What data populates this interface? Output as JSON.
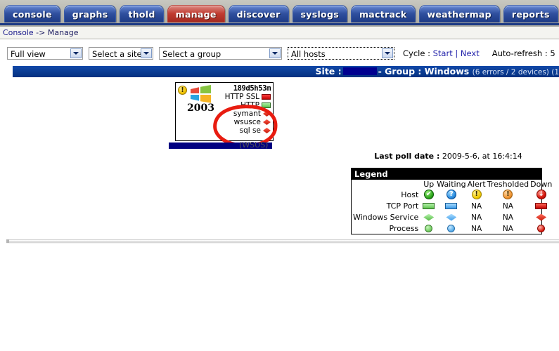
{
  "nav": {
    "tabs": [
      {
        "label": "console",
        "active": false
      },
      {
        "label": "graphs",
        "active": false
      },
      {
        "label": "thold",
        "active": false
      },
      {
        "label": "manage",
        "active": true
      },
      {
        "label": "discover",
        "active": false
      },
      {
        "label": "syslogs",
        "active": false
      },
      {
        "label": "mactrack",
        "active": false
      },
      {
        "label": "weathermap",
        "active": false
      },
      {
        "label": "reports",
        "active": false
      }
    ]
  },
  "breadcrumb": {
    "root": "Console",
    "separator": " -> ",
    "current": "Manage"
  },
  "filters": {
    "view_select": {
      "value": "Full view"
    },
    "site_select": {
      "value": "Select a site"
    },
    "group_select": {
      "value": "Select a group"
    },
    "hosts_select": {
      "value": "All hosts"
    },
    "cycle_label": "Cycle :",
    "cycle_start": "Start",
    "cycle_sep": "|",
    "cycle_next": "Next",
    "autorefresh_label": "Auto-refresh : 5"
  },
  "sitebar": {
    "site_label": "Site :",
    "site_value": "",
    "group_label": "- Group :",
    "group_value": "Windows",
    "stats": "(6 errors / 2 devices) (1"
  },
  "host_card": {
    "status_icon": "warning-icon",
    "os_logo": "windows-logo-icon",
    "os_version": "2003",
    "uptime": "189d5h53m",
    "ports": [
      {
        "label": "HTTP SSL",
        "state": "down",
        "icon": "tcp-port-down-icon"
      },
      {
        "label": "HTTP",
        "state": "up",
        "icon": "tcp-port-up-icon"
      }
    ],
    "services": [
      {
        "label": "symant",
        "state": "down",
        "icon": "windows-service-down-icon"
      },
      {
        "label": "wsusce",
        "state": "down",
        "icon": "windows-service-down-icon"
      },
      {
        "label": "sql se",
        "state": "down",
        "icon": "windows-service-down-icon"
      }
    ],
    "hostname_redacted": "",
    "hostname_suffix": "(WSUS)",
    "annotation": "red-circle-annotation"
  },
  "last_poll": {
    "label": "Last poll date :",
    "value": "2009-5-6, at 16:4:14"
  },
  "legend": {
    "title": "Legend",
    "columns": [
      "Up",
      "Waiting",
      "Alert",
      "Tresholded",
      "Down"
    ],
    "rows": [
      {
        "label": "Host",
        "cells": [
          {
            "kind": "circle",
            "state": "up",
            "icon": "host-up-icon",
            "glyph": "✔",
            "text": ""
          },
          {
            "kind": "circle",
            "state": "wait",
            "icon": "host-waiting-icon",
            "glyph": "?",
            "text": ""
          },
          {
            "kind": "circle",
            "state": "alert",
            "icon": "host-alert-icon",
            "glyph": "!",
            "text": ""
          },
          {
            "kind": "circle",
            "state": "thr",
            "icon": "host-tresholded-icon",
            "glyph": "!",
            "text": ""
          },
          {
            "kind": "circle",
            "state": "down",
            "icon": "host-down-icon",
            "glyph": "↓",
            "text": ""
          }
        ]
      },
      {
        "label": "TCP Port",
        "cells": [
          {
            "kind": "rect",
            "state": "green",
            "icon": "tcp-port-up-icon",
            "glyph": "",
            "text": ""
          },
          {
            "kind": "rect",
            "state": "blue",
            "icon": "tcp-port-waiting-icon",
            "glyph": "",
            "text": ""
          },
          {
            "kind": "na",
            "state": "",
            "icon": "not-available",
            "glyph": "",
            "text": "NA"
          },
          {
            "kind": "na",
            "state": "",
            "icon": "not-available",
            "glyph": "",
            "text": "NA"
          },
          {
            "kind": "rect",
            "state": "red",
            "icon": "tcp-port-down-icon",
            "glyph": "",
            "text": ""
          }
        ]
      },
      {
        "label": "Windows Service",
        "cells": [
          {
            "kind": "diamond",
            "state": "green",
            "icon": "windows-service-up-icon",
            "glyph": "",
            "text": ""
          },
          {
            "kind": "diamond",
            "state": "blue",
            "icon": "windows-service-waiting-icon",
            "glyph": "",
            "text": ""
          },
          {
            "kind": "na",
            "state": "",
            "icon": "not-available",
            "glyph": "",
            "text": "NA"
          },
          {
            "kind": "na",
            "state": "",
            "icon": "not-available",
            "glyph": "",
            "text": "NA"
          },
          {
            "kind": "diamond",
            "state": "red",
            "icon": "windows-service-down-icon",
            "glyph": "",
            "text": ""
          }
        ]
      },
      {
        "label": "Process",
        "cells": [
          {
            "kind": "dot",
            "state": "green",
            "icon": "process-up-icon",
            "glyph": "",
            "text": ""
          },
          {
            "kind": "dot",
            "state": "blue",
            "icon": "process-waiting-icon",
            "glyph": "",
            "text": ""
          },
          {
            "kind": "na",
            "state": "",
            "icon": "not-available",
            "glyph": "",
            "text": "NA"
          },
          {
            "kind": "na",
            "state": "",
            "icon": "not-available",
            "glyph": "",
            "text": "NA"
          },
          {
            "kind": "dot",
            "state": "red",
            "icon": "process-down-icon",
            "glyph": "",
            "text": ""
          }
        ]
      }
    ]
  },
  "colors": {
    "tab_blue": "#2f4f9e",
    "tab_active_red": "#c03b30",
    "titlebar_blue": "#0b3a8c",
    "redaction": "#00008f",
    "annotation_red": "#e81c10",
    "status_up": "#2fa81e",
    "status_waiting": "#2d8fe0",
    "status_alert": "#f2cb00",
    "status_tresholded": "#f09433",
    "status_down": "#d41408"
  }
}
